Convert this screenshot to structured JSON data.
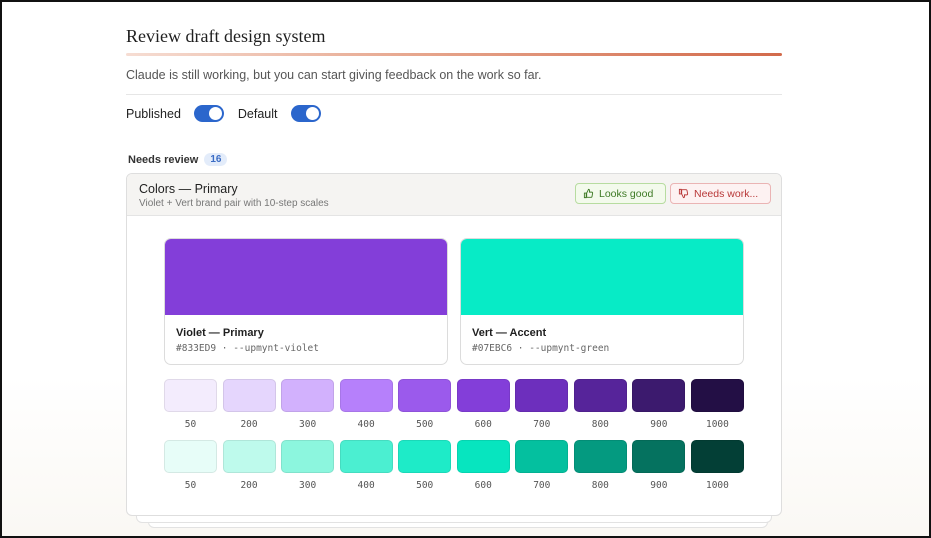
{
  "header": {
    "title": "Review draft design system",
    "progress": 1.0,
    "subtitle": "Claude is still working, but you can start giving feedback on the work so far."
  },
  "toggles": [
    {
      "label": "Published",
      "on": true
    },
    {
      "label": "Default",
      "on": true
    }
  ],
  "review": {
    "heading": "Needs review",
    "count": "16"
  },
  "card": {
    "title": "Colors — Primary",
    "description": "Violet + Vert brand pair with 10-step scales",
    "good_label": "Looks good",
    "work_label": "Needs work...",
    "primary": {
      "name": "Violet — Primary",
      "meta": "#833ED9 · --upmynt-violet",
      "color": "#833ED9"
    },
    "accent": {
      "name": "Vert — Accent",
      "meta": "#07EBC6 · --upmynt-green",
      "color": "#07EBC6"
    },
    "violet_scale": [
      {
        "label": "50",
        "color": "#F3ECFD"
      },
      {
        "label": "200",
        "color": "#E5D6FD"
      },
      {
        "label": "300",
        "color": "#D2B1FD"
      },
      {
        "label": "400",
        "color": "#B680FB"
      },
      {
        "label": "500",
        "color": "#9B5AEC"
      },
      {
        "label": "600",
        "color": "#833ED9"
      },
      {
        "label": "700",
        "color": "#6D2FBD"
      },
      {
        "label": "800",
        "color": "#56249A"
      },
      {
        "label": "900",
        "color": "#3C1A6E"
      },
      {
        "label": "1000",
        "color": "#230F45"
      }
    ],
    "vert_scale": [
      {
        "label": "50",
        "color": "#E7FDF8"
      },
      {
        "label": "200",
        "color": "#BEFAEC"
      },
      {
        "label": "300",
        "color": "#8CF6DE"
      },
      {
        "label": "400",
        "color": "#4BEFD1"
      },
      {
        "label": "500",
        "color": "#1EEBC8"
      },
      {
        "label": "600",
        "color": "#07E5BF"
      },
      {
        "label": "700",
        "color": "#04C09F"
      },
      {
        "label": "800",
        "color": "#049A80"
      },
      {
        "label": "900",
        "color": "#05725F"
      },
      {
        "label": "1000",
        "color": "#033F36"
      }
    ]
  }
}
